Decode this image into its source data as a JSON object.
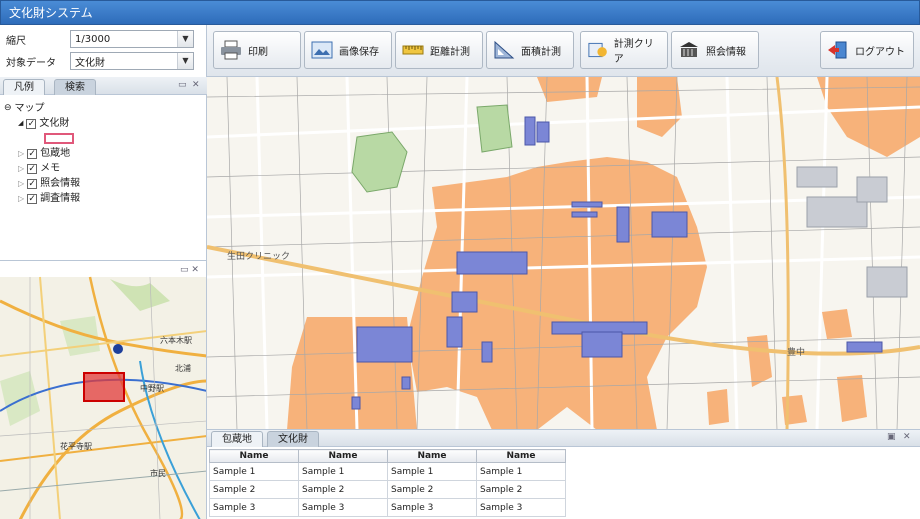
{
  "window": {
    "title": "文化財システム"
  },
  "settings": {
    "scale_label": "縮尺",
    "scale_value": "1/3000",
    "target_label": "対象データ",
    "target_value": "文化財"
  },
  "toolbar": {
    "print": "印刷",
    "save_image": "画像保存",
    "measure_distance": "距離計測",
    "measure_area": "面積計測",
    "clear_measure": "計測クリア",
    "meeting_info": "照会情報",
    "logout": "ログアウト"
  },
  "left_panel": {
    "tabs": [
      "凡例",
      "検索"
    ],
    "tree": {
      "root": "マップ",
      "items": [
        {
          "label": "文化財",
          "checked": true,
          "expanded": true
        },
        {
          "label": "包蔵地",
          "checked": true
        },
        {
          "label": "メモ",
          "checked": true
        },
        {
          "label": "照会情報",
          "checked": true
        },
        {
          "label": "調査情報",
          "checked": true
        }
      ]
    }
  },
  "overview_map": {
    "labels": [
      "六本木駅",
      "中野駅",
      "花平寺駅",
      "北浦",
      "市民"
    ]
  },
  "main_map": {
    "labels": [
      "生田クリニック",
      "豊中"
    ]
  },
  "bottom_panel": {
    "tabs": [
      "包蔵地",
      "文化財"
    ],
    "columns": [
      "Name",
      "Name",
      "Name",
      "Name"
    ],
    "rows": [
      [
        "Sample 1",
        "Sample 1",
        "Sample 1",
        "Sample 1"
      ],
      [
        "Sample 2",
        "Sample 2",
        "Sample 2",
        "Sample 2"
      ],
      [
        "Sample 3",
        "Sample 3",
        "Sample 3",
        "Sample 3"
      ]
    ]
  },
  "colors": {
    "title_bar": "#3a7cc8",
    "heritage_zone": "#f7b27a",
    "heritage_building": "#7b86d6",
    "overview_highlight": "#e02020"
  }
}
